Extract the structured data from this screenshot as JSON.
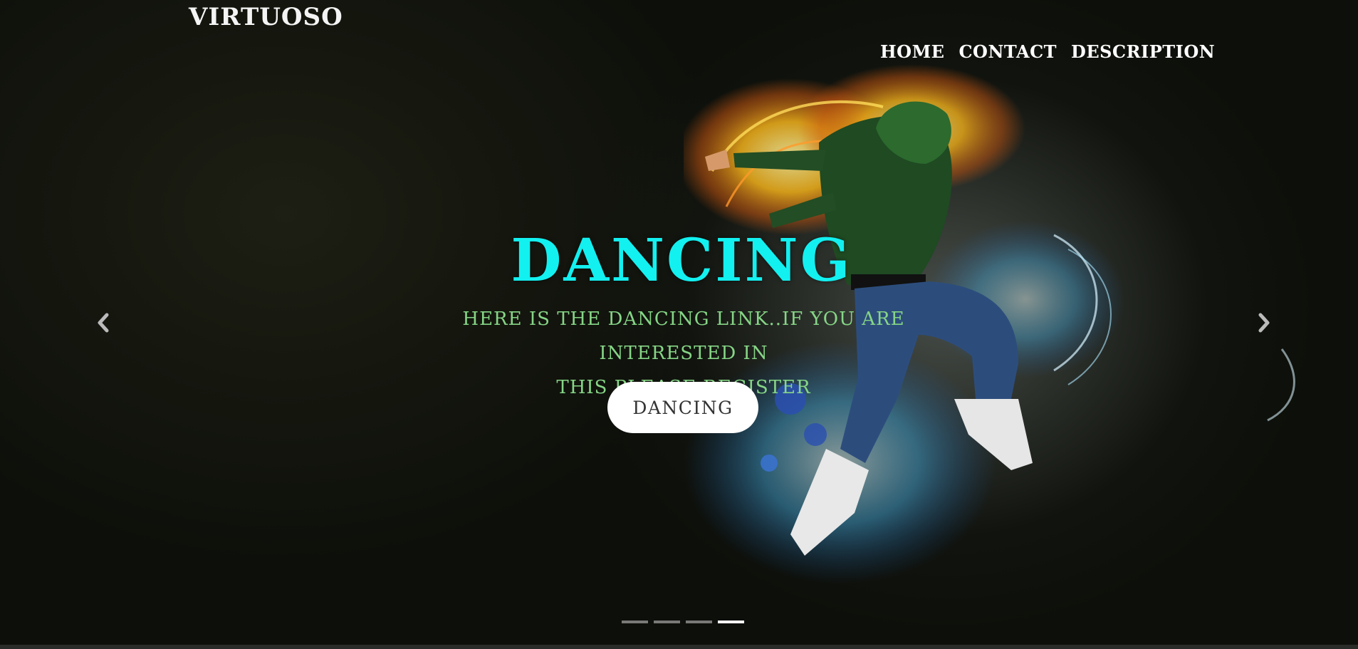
{
  "brand": {
    "logo": "VIRTUOSO"
  },
  "nav": {
    "items": [
      "HOME",
      "CONTACT",
      "DESCRIPTION"
    ]
  },
  "hero": {
    "title": "DANCING",
    "text_line1": "HERE IS THE DANCING LINK..IF YOU ARE INTERESTED IN",
    "text_line2": "THIS PLEASE REGISTER",
    "button_label": "DANCING"
  },
  "carousel": {
    "prev_icon": "chevron-left-icon",
    "next_icon": "chevron-right-icon",
    "slide_count": 4,
    "active_slide": 4
  },
  "colors": {
    "title": "#13f0f0",
    "subtitle": "#86d586",
    "button_bg": "#ffffff",
    "background": "#080906"
  }
}
